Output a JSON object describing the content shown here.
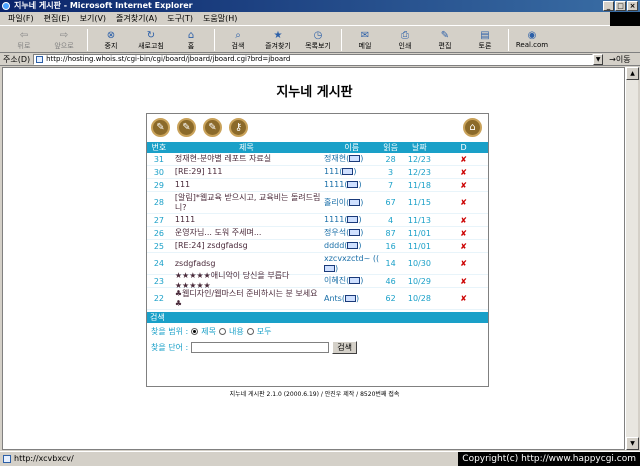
{
  "window": {
    "title": "지누네 게시판 - Microsoft Internet Explorer",
    "controls": [
      "_",
      "□",
      "×"
    ]
  },
  "menu": [
    "파일(F)",
    "편집(E)",
    "보기(V)",
    "즐겨찾기(A)",
    "도구(T)",
    "도움말(H)"
  ],
  "toolbar": [
    {
      "label": "뒤로",
      "icon": "back-arrow-icon",
      "glyph": "⇦",
      "disabled": true
    },
    {
      "label": "앞으로",
      "icon": "forward-arrow-icon",
      "glyph": "⇨",
      "disabled": true
    },
    {
      "label": "중지",
      "icon": "stop-icon",
      "glyph": "⊗",
      "disabled": false
    },
    {
      "label": "새로고침",
      "icon": "refresh-icon",
      "glyph": "↻",
      "disabled": false
    },
    {
      "label": "홈",
      "icon": "home-icon",
      "glyph": "⌂",
      "disabled": false
    },
    {
      "label": "검색",
      "icon": "search-icon",
      "glyph": "⌕",
      "disabled": false
    },
    {
      "label": "즐겨찾기",
      "icon": "favorites-icon",
      "glyph": "★",
      "disabled": false
    },
    {
      "label": "목록보기",
      "icon": "history-icon",
      "glyph": "◷",
      "disabled": false
    },
    {
      "label": "메일",
      "icon": "mail-icon",
      "glyph": "✉",
      "disabled": false
    },
    {
      "label": "인쇄",
      "icon": "print-icon",
      "glyph": "⎙",
      "disabled": false
    },
    {
      "label": "편집",
      "icon": "edit-icon",
      "glyph": "✎",
      "disabled": false
    },
    {
      "label": "토론",
      "icon": "discuss-icon",
      "glyph": "▤",
      "disabled": false
    },
    {
      "label": "Real.com",
      "icon": "realplayer-icon",
      "glyph": "◉",
      "disabled": false
    }
  ],
  "address": {
    "label": "주소(D)",
    "url": "http://hosting.whois.st/cgi-bin/cgi/board/jboard/jboard.cgi?brd=jboard",
    "go_label": "이동"
  },
  "board": {
    "title": "지누네 게시판",
    "headers": {
      "no": "번호",
      "title": "제목",
      "name": "이름",
      "read": "읽음",
      "date": "날짜",
      "del": "D"
    },
    "rows": [
      {
        "no": "31",
        "title": "정재현-분야별 레포트 자료실",
        "name": "정재현",
        "read": "28",
        "date": "12/23"
      },
      {
        "no": "30",
        "title": "[RE:29] 111",
        "name": "111",
        "read": "3",
        "date": "12/23"
      },
      {
        "no": "29",
        "title": "111",
        "name": "1111",
        "read": "7",
        "date": "11/18"
      },
      {
        "no": "28",
        "title": "[알림]*웹교육 받으시고, 교육비는 돌려드립니?",
        "name": "홀리이",
        "read": "67",
        "date": "11/15"
      },
      {
        "no": "27",
        "title": "1111",
        "name": "1111",
        "read": "4",
        "date": "11/13"
      },
      {
        "no": "26",
        "title": "운영자님... 도워 주세며...",
        "name": "정우석",
        "read": "87",
        "date": "11/01"
      },
      {
        "no": "25",
        "title": "[RE:24] zsdgfadsg",
        "name": "dddd",
        "read": "16",
        "date": "11/01"
      },
      {
        "no": "24",
        "title": "zsdgfadsg",
        "name": "xzcvxzctd~ (",
        "read": "14",
        "date": "10/30"
      },
      {
        "no": "23",
        "title": "★★★★★애니악이 당신을 부릅다★★★★★",
        "name": "이혜진",
        "read": "46",
        "date": "10/29"
      },
      {
        "no": "22",
        "title": "♣웹디자인/웹마스터 준비하시는 분 보세요♣",
        "name": "Ants",
        "read": "62",
        "date": "10/28"
      }
    ],
    "del_mark": "✘",
    "search": {
      "header": "검색",
      "range_label": "찾을 범위 :",
      "options": [
        "제목",
        "내용",
        "모두"
      ],
      "word_label": "찾을 단어 :",
      "button": "검색"
    },
    "footer": "지누네 게시판 2.1.0 (2000.6.19) / 안진우 제작 / 8520번째 접속"
  },
  "status": {
    "text": "http://xcvbxcv/",
    "copyright": "Copyright(c) http://www.happycgi.com"
  }
}
